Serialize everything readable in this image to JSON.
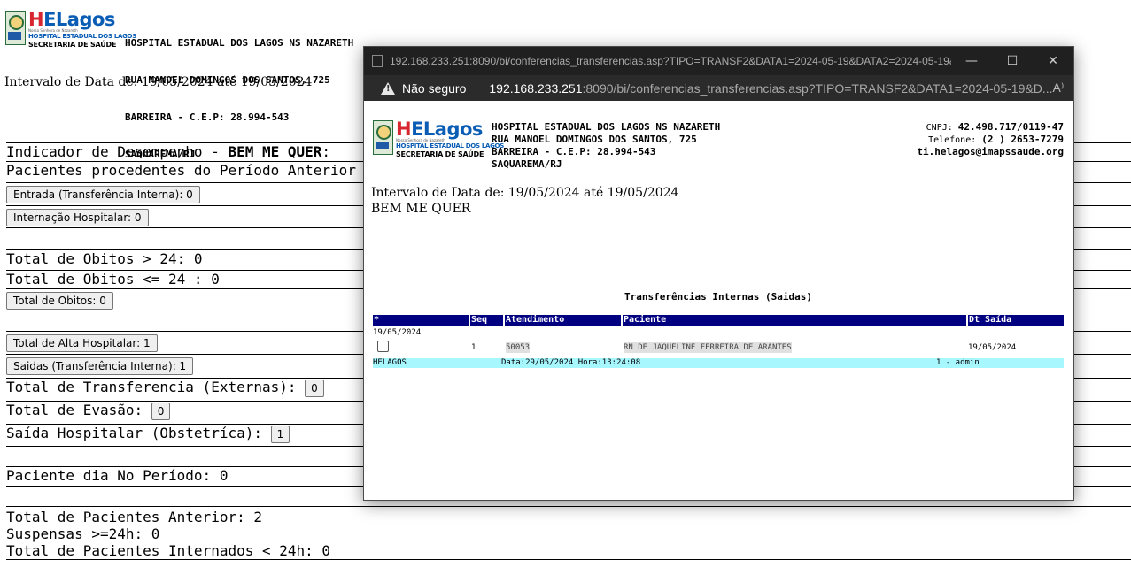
{
  "report": {
    "logo_name_h": "H",
    "logo_name_rest": "ELagos",
    "logo_line1": "Nossa Senhora de Nazareth",
    "logo_line2": "HOSPITAL ESTADUAL DOS LAGOS",
    "logo_line3": "SECRETARIA DE SAÚDE",
    "hospital_name": "HOSPITAL ESTADUAL DOS LAGOS NS NAZARETH",
    "address1": "RUA MANOEL DOMINGOS DOS SANTOS, 725",
    "address2": "BARREIRA - C.E.P: 28.994-543",
    "city": "SAQUAREMA/RJ",
    "interval": "Intervalo de Data de: 19/05/2024 até 19/05/2024"
  },
  "indicators": {
    "title_prefix": "Indicador de Desempenho - ",
    "title_bold": "BEM ME QUER",
    "title_suffix": ":",
    "pacientes_anterior": "Pacientes procedentes do Período Anterior (Obstetrica): 2",
    "entrada_btn": "Entrada (Transferência Interna): 0",
    "internacao_btn": "Internação Hospitalar: 0",
    "obitos_gt24": "Total de Obitos > 24: 0",
    "obitos_le24": "Total de Obitos <= 24 : 0",
    "total_obitos_btn": "Total de Obitos: 0",
    "alta_btn": "Total de Alta Hospitalar: 1",
    "saidas_btn": "Saidas (Transferência Interna): 1",
    "transf_externas_label": "Total de Transferencia (Externas):",
    "transf_externas_value": "0",
    "evasao_label": "Total de Evasão:",
    "evasao_value": "0",
    "saida_obst_label": "Saída Hospitalar (Obstetríca):",
    "saida_obst_value": "1",
    "paciente_dia": "Paciente dia No Período: 0",
    "total_pac_anterior": "Total de Pacientes Anterior: 2",
    "suspensas": "Suspensas >=24h: 0",
    "internados_lt24": "Total de Pacientes Internados < 24h: 0"
  },
  "popup": {
    "window_title": "192.168.233.251:8090/bi/conferencias_transferencias.asp?TIPO=TRANSF2&DATA1=2024-05-19&DATA2=2024-05-19&...",
    "not_secure": "Não seguro",
    "url_host": "192.168.233.251",
    "url_path": ":8090/bi/conferencias_transferencias.asp?TIPO=TRANSF2&DATA1=2024-05-19&D...",
    "read_aloud": "A⁾",
    "cnpj_label": "CNPJ: ",
    "cnpj_value": "42.498.717/0119-47",
    "phone_label": "Telefone: ",
    "phone_value": "(2 ) 2653-7279",
    "email": "ti.helagos@imapssaude.org",
    "interval": "Intervalo de Data de: 19/05/2024 até 19/05/2024",
    "subtitle": "BEM ME QUER",
    "table_title": "Transferências Internas (Saidas)",
    "columns": [
      "*",
      "Seq",
      "Atendimento",
      "Paciente",
      "Dt Saída"
    ],
    "group_date": "19/05/2024",
    "row": {
      "seq": "1",
      "atendimento": "50053",
      "paciente": "RN DE JAQUELINE FERREIRA DE ARANTES",
      "dt_saida": "19/05/2024"
    },
    "footer": {
      "unit": "HELAGOS",
      "datetime": "Data:29/05/2024 Hora:13:24:08",
      "user": "1 - admin"
    }
  }
}
